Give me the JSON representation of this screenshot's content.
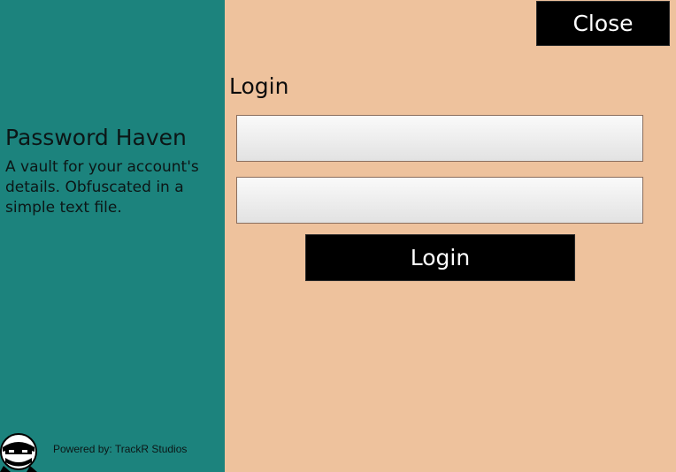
{
  "sidebar": {
    "title": "Password Haven",
    "tagline": "A vault for your account's details. Obfuscated in a simple text file.",
    "powered_by": "Powered by: TrackR Studios",
    "logo_icon": "ninja-mascot-icon",
    "background_color": "#1C837D"
  },
  "header": {
    "close_label": "Close"
  },
  "login": {
    "heading": "Login",
    "username_value": "",
    "password_value": "",
    "submit_label": "Login"
  },
  "colors": {
    "main_background": "#EEC29D",
    "button_background": "#000000",
    "button_text": "#FFFFFF"
  }
}
